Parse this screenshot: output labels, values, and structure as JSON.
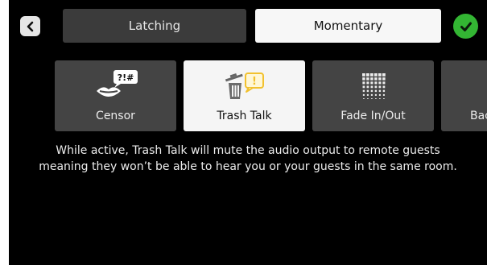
{
  "mode_selector": {
    "latching_label": "Latching",
    "momentary_label": "Momentary",
    "selected": "Momentary"
  },
  "effects": [
    {
      "label": "Censor",
      "icon": "censor-icon",
      "glyph": "?!#"
    },
    {
      "label": "Trash Talk",
      "icon": "trash-talk-icon",
      "glyph": "!"
    },
    {
      "label": "Fade In/Out",
      "icon": "fade-icon"
    },
    {
      "label": "Back",
      "icon": ""
    }
  ],
  "selected_effect": "Trash Talk",
  "description": {
    "line1": "While active, Trash Talk will mute the audio output to remote guests",
    "line2": "meaning they won’t be able to hear you or your guests in the same room."
  },
  "colors": {
    "background": "#000000",
    "tile": "#444444",
    "tile_selected": "#f5f5f5",
    "confirm": "#33b533",
    "accent_yellow": "#f2c12e"
  }
}
